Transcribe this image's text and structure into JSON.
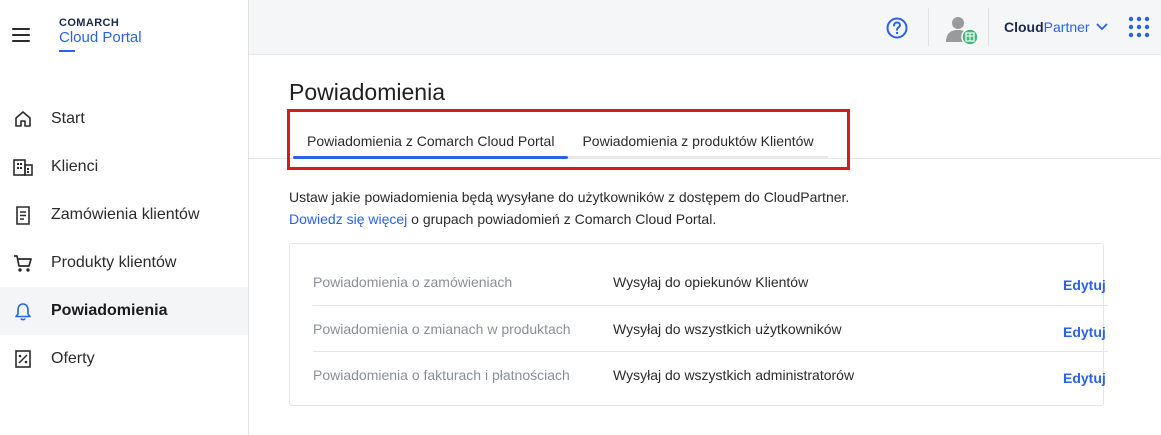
{
  "logo": {
    "top": "COMARCH",
    "bottom": "Cloud Portal"
  },
  "sidebar": {
    "items": [
      {
        "label": "Start",
        "icon": "home-icon"
      },
      {
        "label": "Klienci",
        "icon": "building-icon"
      },
      {
        "label": "Zamówienia klientów",
        "icon": "document-icon"
      },
      {
        "label": "Produkty klientów",
        "icon": "cart-icon"
      },
      {
        "label": "Powiadomienia",
        "icon": "bell-icon",
        "active": true
      },
      {
        "label": "Oferty",
        "icon": "percent-icon"
      }
    ]
  },
  "header": {
    "account_bold": "Cloud",
    "account_accent": "Partner"
  },
  "main": {
    "title": "Powiadomienia",
    "tabs": [
      {
        "label": "Powiadomienia z Comarch Cloud Portal",
        "active": true
      },
      {
        "label": "Powiadomienia z produktów Klientów",
        "active": false
      }
    ],
    "intro_line1": "Ustaw jakie powiadomienia będą wysyłane do użytkowników z dostępem do CloudPartner.",
    "intro_link": "Dowiedz się więcej",
    "intro_line2_rest": " o grupach powiadomień z Comarch Cloud Portal.",
    "rows": [
      {
        "name": "Powiadomienia o zamówieniach",
        "value": "Wysyłaj do opiekunów Klientów",
        "action": "Edytuj"
      },
      {
        "name": "Powiadomienia o zmianach w produktach",
        "value": "Wysyłaj do wszystkich użytkowników",
        "action": "Edytuj"
      },
      {
        "name": "Powiadomienia o fakturach i płatnościach",
        "value": "Wysyłaj do wszystkich administratorów",
        "action": "Edytuj"
      }
    ]
  },
  "colors": {
    "accent": "#2b61e6",
    "highlight": "#d41c1c",
    "brand_dark": "#1b2a4a"
  }
}
